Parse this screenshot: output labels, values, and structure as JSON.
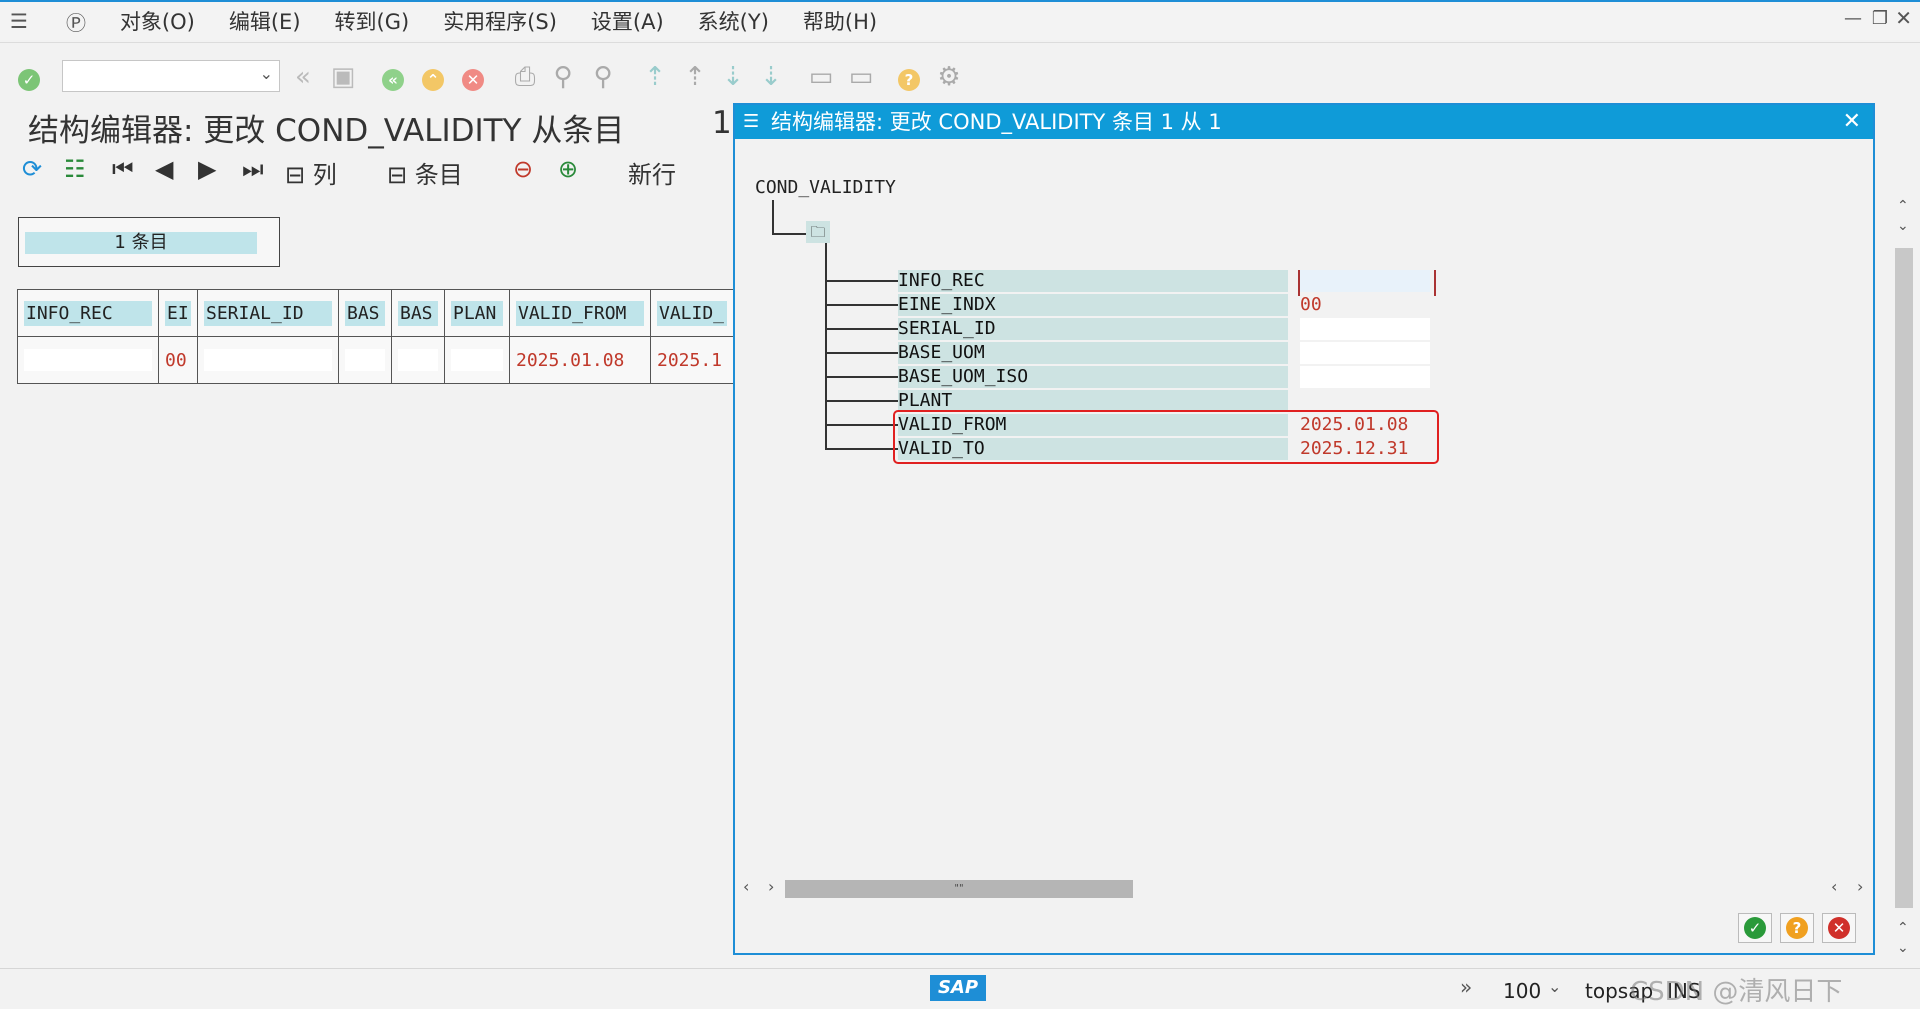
{
  "menu": {
    "items": [
      "对象(O)",
      "编辑(E)",
      "转到(G)",
      "实用程序(S)",
      "设置(A)",
      "系统(Y)",
      "帮助(H)"
    ]
  },
  "page": {
    "title": "结构编辑器: 更改 COND_VALIDITY 从条目",
    "title_suffix": "1",
    "app_toolbar": {
      "columns_label": "列",
      "entries_label": "条目",
      "new_row_label": "新行"
    },
    "entries_box": "1  条目",
    "grid": {
      "headers": [
        "INFO_REC",
        "EI",
        "SERIAL_ID",
        "BAS",
        "BAS",
        "PLAN",
        "VALID_FROM",
        "VALID_"
      ],
      "row": [
        "",
        "00",
        "",
        "",
        "",
        "",
        "2025.01.08",
        "2025.1"
      ]
    }
  },
  "dialog": {
    "title": "结构编辑器: 更改 COND_VALIDITY 条目 1 从 1",
    "root": "COND_VALIDITY",
    "fields": [
      {
        "name": "INFO_REC",
        "value": ""
      },
      {
        "name": "EINE_INDX",
        "value": "00"
      },
      {
        "name": "SERIAL_ID",
        "value": ""
      },
      {
        "name": "BASE_UOM",
        "value": ""
      },
      {
        "name": "BASE_UOM_ISO",
        "value": ""
      },
      {
        "name": "PLANT",
        "value": ""
      },
      {
        "name": "VALID_FROM",
        "value": "2025.01.08"
      },
      {
        "name": "VALID_TO",
        "value": "2025.12.31"
      }
    ],
    "scroll_thumb": "\"\""
  },
  "status": {
    "zoom": "100",
    "system": "topsap",
    "mode": "INS",
    "logo": "SAP",
    "watermark": "CSDN @清风日下"
  },
  "colors": {
    "accent": "#0f9bd8",
    "value_red": "#c0392b",
    "field_bg": "#cde3e2",
    "highlight": "#e02020"
  }
}
